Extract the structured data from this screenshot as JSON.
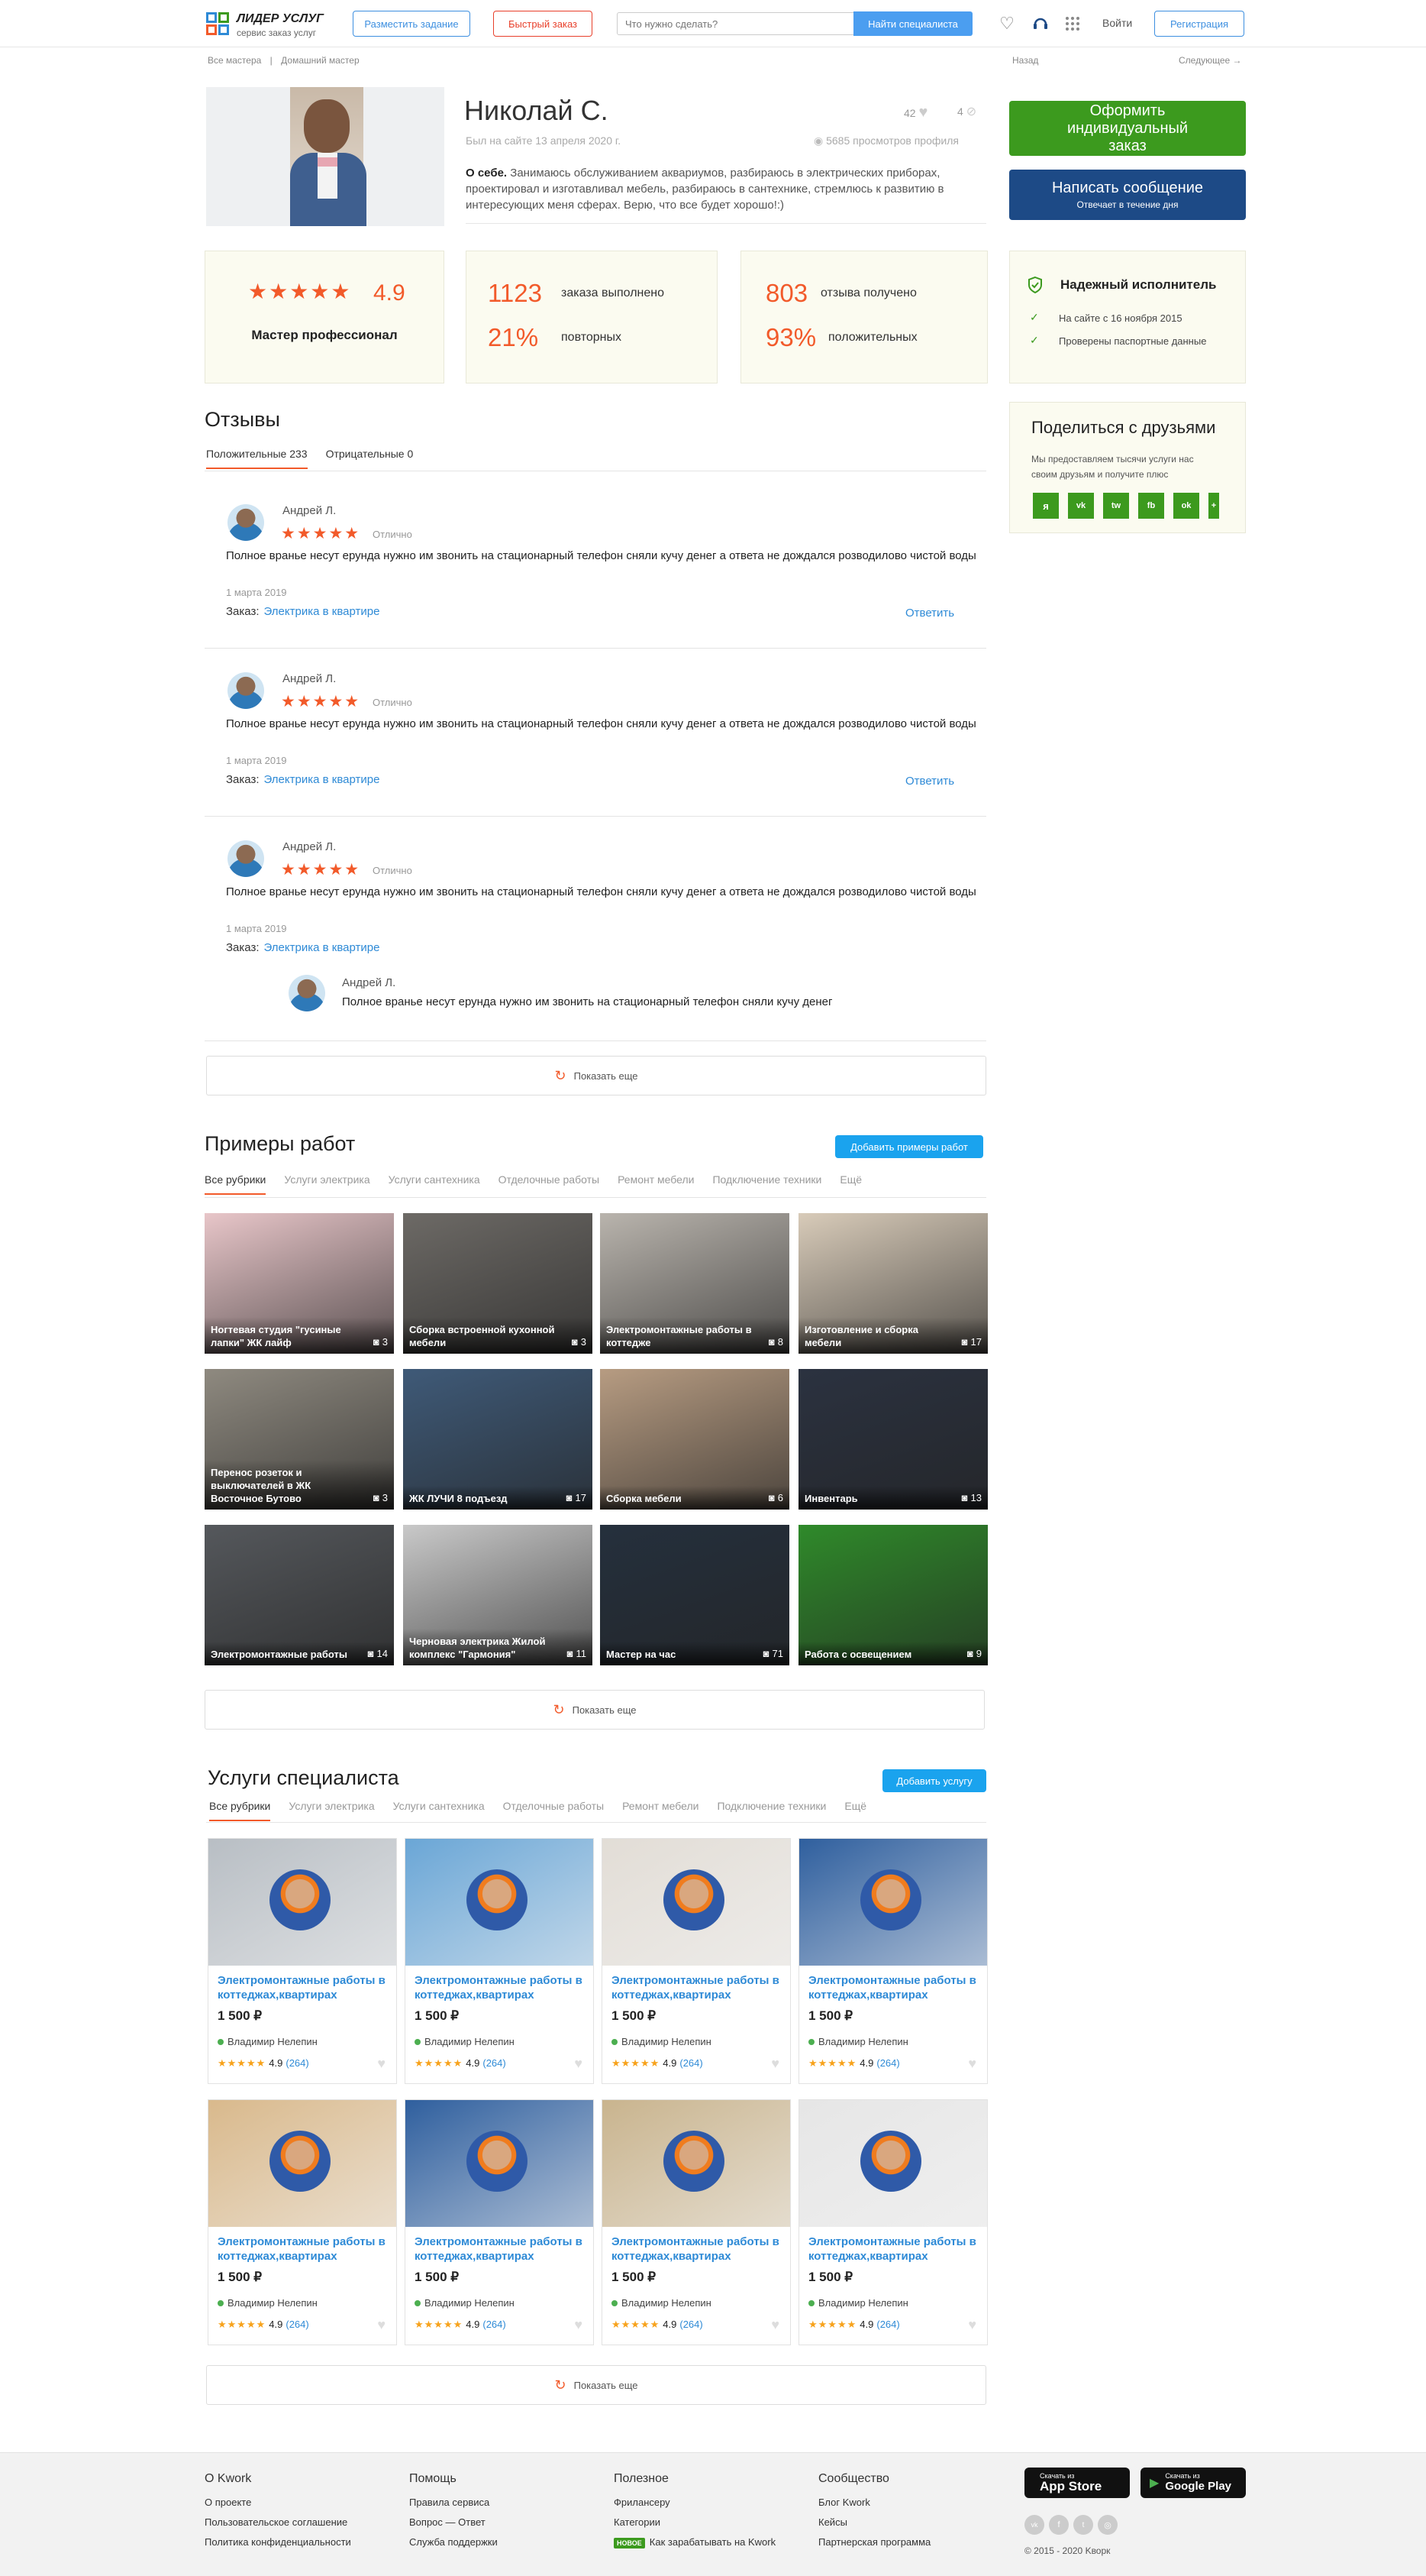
{
  "header": {
    "logo_title": "ЛИДЕР УСЛУГ",
    "logo_sub": "сервис заказ услуг",
    "post_task": "Разместить задание",
    "quick_order": "Быстрый заказ",
    "search_placeholder": "Что нужно сделать?",
    "search_button": "Найти специалиста",
    "login": "Войти",
    "register": "Регистрация"
  },
  "breadcrumbs": {
    "all": "Все мастера",
    "sep": "|",
    "current": "Домашний мастер",
    "back": "Назад",
    "next": "Следующее →"
  },
  "profile": {
    "name": "Николай С.",
    "since": "Был на сайте 13 апреля 2020 г.",
    "likes": "42",
    "hidden": "4",
    "views": "5685 просмотров профиля",
    "about_label": "О себе.",
    "about_text": "Занимаюсь обслуживанием аквариумов, разбираюсь в электрических приборах, проектировал и изготавливал мебель, разбираюсь в сантехнике, стремлюсь к развитию в интересующих меня сферах. Верю, что все будет хорошо!:)"
  },
  "actions": {
    "order": "Оформить индивидуальный заказ",
    "message": "Написать сообщение",
    "message_sub": "Отвечает в течение дня"
  },
  "stats": {
    "rating": "4.9",
    "rating_stars": 5,
    "level": "Мастер профессионал",
    "orders_done": "1123",
    "orders_done_label": "заказа выполнено",
    "repeat": "21%",
    "repeat_label": "повторных",
    "reviews_got": "803",
    "reviews_got_label": "отзыва получено",
    "positive": "93%",
    "positive_label": "положительных"
  },
  "trust": {
    "title": "Надежный исполнитель",
    "items": [
      "На сайте с 16 ноября 2015",
      "Проверены паспортные данные"
    ]
  },
  "share": {
    "title": "Поделиться с друзьями",
    "text": "Мы предоставляем тысячи услуги нас своим друзьям и получите плюс",
    "icons": [
      "я",
      "vk",
      "tw",
      "fb",
      "ok",
      "+"
    ]
  },
  "reviews": {
    "title": "Отзывы",
    "tab_positive": "Положительные 233",
    "tab_negative": "Отрицательные 0",
    "order_label": "Заказ:",
    "reply": "Ответить",
    "items": [
      {
        "name": "Андрей Л.",
        "grade": "Отлично",
        "text": "Полное вранье несут ерунда нужно им звонить на стационарный телефон сняли кучу денег а  ответа не дождался розводилово чистой воды",
        "date": "1 марта 2019",
        "order": "Электрика в квартире"
      },
      {
        "name": "Андрей Л.",
        "grade": "Отлично",
        "text": "Полное вранье несут ерунда нужно им звонить на стационарный телефон сняли кучу денег а  ответа не дождался розводилово чистой воды",
        "date": "1 марта 2019",
        "order": "Электрика в квартире"
      },
      {
        "name": "Андрей Л.",
        "grade": "Отлично",
        "text": "Полное вранье несут ерунда нужно им звонить на стационарный телефон сняли кучу денег а  ответа не дождался розводилово чистой воды",
        "date": "1 марта 2019",
        "order": "Электрика в квартире"
      }
    ],
    "answer": {
      "name": "Андрей Л.",
      "text": "Полное вранье несут ерунда нужно им звонить на стационарный телефон сняли кучу денег"
    },
    "show_more": "Показать еще"
  },
  "works": {
    "title": "Примеры работ",
    "add": "Добавить примеры работ",
    "tabs": [
      "Все рубрики",
      "Услуги электрика",
      "Услуги сантехника",
      "Отделочные работы",
      "Ремонт мебели",
      "Подключение техники",
      "Ещё"
    ],
    "items": [
      {
        "title": "Ногтевая студия \"гусиные лапки\" ЖК лайф",
        "count": "3",
        "color": "#e8c6c9"
      },
      {
        "title": "Сборка встроенной кухонной мебели",
        "count": "3",
        "color": "#6d6a66"
      },
      {
        "title": "Электромонтажные работы в коттедже",
        "count": "8",
        "color": "#b9b4ad"
      },
      {
        "title": "Изготовление и сборка мебели",
        "count": "17",
        "color": "#d8cbb9"
      },
      {
        "title": "Перенос розеток и выключателей в ЖК Восточное Бутово",
        "count": "3",
        "color": "#8f8a80"
      },
      {
        "title": "ЖК ЛУЧИ 8 подъезд",
        "count": "17",
        "color": "#3f5a78"
      },
      {
        "title": "Сборка мебели",
        "count": "6",
        "color": "#b79c82"
      },
      {
        "title": "Инвентарь",
        "count": "13",
        "color": "#2b3240"
      },
      {
        "title": "Электромонтажные работы",
        "count": "14",
        "color": "#55585c"
      },
      {
        "title": "Черновая электрика Жилой комплекс \"Гармония\"",
        "count": "11",
        "color": "#c9c9c9"
      },
      {
        "title": "Мастер на час",
        "count": "71",
        "color": "#25303d"
      },
      {
        "title": "Работа с освещением",
        "count": "9",
        "color": "#2f8a2a"
      }
    ],
    "show_more": "Показать еще"
  },
  "services": {
    "title": "Услуги специалиста",
    "add": "Добавить услугу",
    "tabs": [
      "Все рубрики",
      "Услуги электрика",
      "Услуги сантехника",
      "Отделочные работы",
      "Ремонт мебели",
      "Подключение техники",
      "Ещё"
    ],
    "items": [
      {
        "title": "Электромонтажные работы в коттеджах,квартирах",
        "price": "1 500 ₽",
        "author": "Владимир Нелепин",
        "rating": "4.9",
        "reviews": "(264)",
        "color": "#b8bec4"
      },
      {
        "title": "Электромонтажные работы в коттеджах,квартирах",
        "price": "1 500 ₽",
        "author": "Владимир Нелепин",
        "rating": "4.9",
        "reviews": "(264)",
        "color": "#6aa6d6"
      },
      {
        "title": "Электромонтажные работы в коттеджах,квартирах",
        "price": "1 500 ₽",
        "author": "Владимир Нелепин",
        "rating": "4.9",
        "reviews": "(264)",
        "color": "#e2ddd6"
      },
      {
        "title": "Электромонтажные работы в коттеджах,квартирах",
        "price": "1 500 ₽",
        "author": "Владимир Нелепин",
        "rating": "4.9",
        "reviews": "(264)",
        "color": "#2f5f9e"
      },
      {
        "title": "Электромонтажные работы в коттеджах,квартирах",
        "price": "1 500 ₽",
        "author": "Владимир Нелепин",
        "rating": "4.9",
        "reviews": "(264)",
        "color": "#d9b98c"
      },
      {
        "title": "Электромонтажные работы в коттеджах,квартирах",
        "price": "1 500 ₽",
        "author": "Владимир Нелепин",
        "rating": "4.9",
        "reviews": "(264)",
        "color": "#2f5f9e"
      },
      {
        "title": "Электромонтажные работы в коттеджах,квартирах",
        "price": "1 500 ₽",
        "author": "Владимир Нелепин",
        "rating": "4.9",
        "reviews": "(264)",
        "color": "#c9b48e"
      },
      {
        "title": "Электромонтажные работы в коттеджах,квартирах",
        "price": "1 500 ₽",
        "author": "Владимир Нелепин",
        "rating": "4.9",
        "reviews": "(264)",
        "color": "#e6e6e6"
      }
    ],
    "show_more": "Показать еще"
  },
  "footer": {
    "col1": {
      "title": "О Kwork",
      "links": [
        "О проекте",
        "Пользовательское соглашение",
        "Политика конфиденциальности"
      ]
    },
    "col2": {
      "title": "Помощь",
      "links": [
        "Правила сервиса",
        "Вопрос — Ответ",
        "Служба поддержки"
      ]
    },
    "col3": {
      "title": "Полезное",
      "links": [
        "Фрилансеру",
        "Категории"
      ],
      "badge": "НОВОЕ",
      "badge_link": "Как зарабатывать на Kwork"
    },
    "col4": {
      "title": "Сообщество",
      "links": [
        "Блог Kwork",
        "Кейсы",
        "Партнерская программа"
      ]
    },
    "appstore_small": "Скачать из",
    "appstore": "App Store",
    "gplay_small": "Скачать из",
    "gplay": "Google Play",
    "copyright": "© 2015 - 2020 Kворк"
  },
  "colors": {
    "accent": "#f25a2a",
    "green": "#3c9a1e",
    "navy": "#1d4a86",
    "link": "#2e8ad6",
    "blue_btn": "#1aa3ee"
  }
}
